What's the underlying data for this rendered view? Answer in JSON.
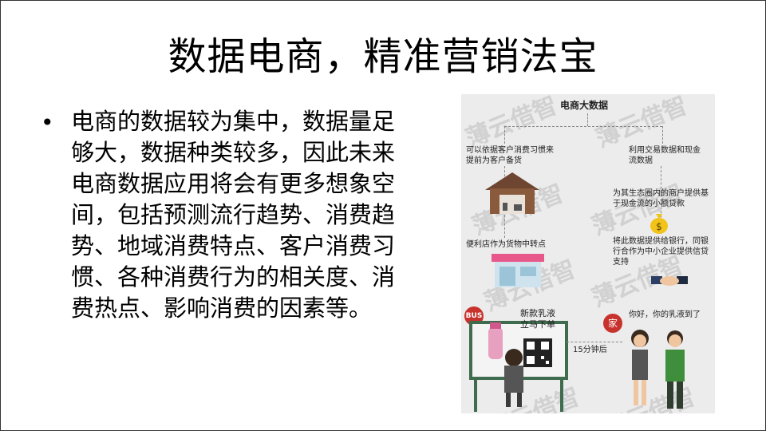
{
  "title": "数据电商，精准营销法宝",
  "bullet": "电商的数据较为集中，数据量足够大，数据种类较多，因此未来电商数据应用将会有更多想象空间，包括预测流行趋势、消费趋势、地域消费特点、客户消费习惯、各种消费行为的相关度、消费热点、影响消费的因素等。",
  "infographic": {
    "top_label": "电商大数据",
    "left_branch": "可以依据客户消费习惯来提前为客户备货",
    "right_branch": "利用交易数据和现金流数据",
    "merchant_loan": "为其生态圈内的商户提供基于现金流的小额贷款",
    "convenience_store": "便利店作为货物中转点",
    "bank_data": "将此数据提供给银行，同银行合作为中小企业提供信贷支持",
    "bus_badge": "BUS",
    "new_milk": "新款乳液立马下单",
    "home_badge": "家",
    "delivery_time": "15分钟后",
    "dialog": "你好，你的乳液到了",
    "watermark": "薄云借智",
    "money_symbol": "$"
  },
  "colors": {
    "bus_red": "#c8322c",
    "bus_frame": "#3f6b4e",
    "awning_pink": "#e7578a",
    "house_brown": "#8a5a3c",
    "money_yellow": "#f2c318"
  }
}
